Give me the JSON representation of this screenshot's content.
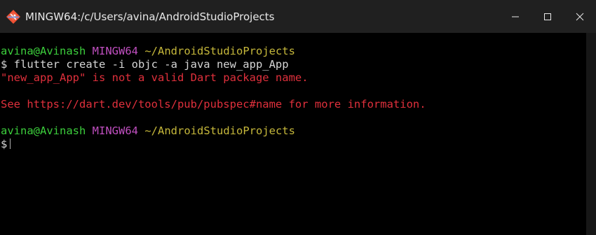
{
  "window": {
    "title": "MINGW64:/c/Users/avina/AndroidStudioProjects",
    "icon": "git-bash-icon",
    "controls": {
      "minimize": "minimize-icon",
      "maximize": "maximize-icon",
      "close": "close-icon"
    }
  },
  "terminal": {
    "prompt1": {
      "user": "avina@Avinash",
      "env": "MINGW64",
      "path": "~/AndroidStudioProjects"
    },
    "command": "$ flutter create -i objc -a java new_app_App",
    "error1": "\"new_app_App\" is not a valid Dart package name.",
    "error2": "See https://dart.dev/tools/pub/pubspec#name for more information.",
    "prompt2": {
      "user": "avina@Avinash",
      "env": "MINGW64",
      "path": "~/AndroidStudioProjects"
    },
    "input_prompt": "$"
  },
  "colors": {
    "user": "#3ccf3c",
    "env": "#c04fc0",
    "path": "#c6b83b",
    "error": "#e0303c",
    "text": "#d6d6d6",
    "background": "#000000",
    "titlebar": "#202020"
  }
}
